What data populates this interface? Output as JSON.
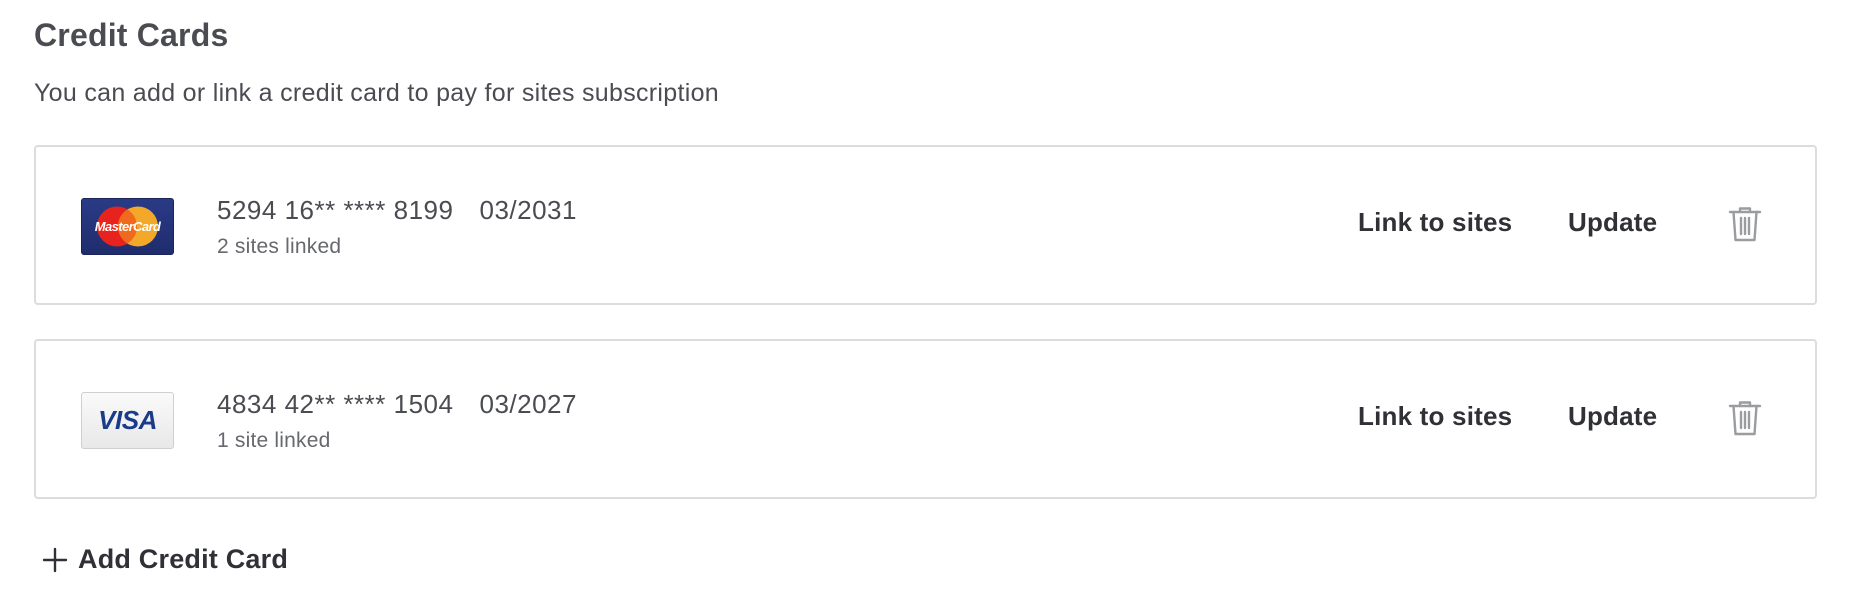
{
  "section": {
    "title": "Credit Cards",
    "subtitle": "You can add or link a credit card to pay for sites subscription"
  },
  "cards": [
    {
      "brand": "MasterCard",
      "logo_icon": "mastercard-logo",
      "number": "5294 16** **** 8199",
      "expiry": "03/2031",
      "linked": "2 sites linked",
      "link_label": "Link to sites",
      "update_label": "Update",
      "delete_icon": "trash-icon"
    },
    {
      "brand": "VISA",
      "logo_icon": "visa-logo",
      "number": "4834 42** **** 1504",
      "expiry": "03/2027",
      "linked": "1 site linked",
      "link_label": "Link to sites",
      "update_label": "Update",
      "delete_icon": "trash-icon"
    }
  ],
  "add_card": {
    "label": "Add Credit Card",
    "icon": "plus-icon"
  },
  "colors": {
    "text_primary": "#2f3136",
    "text_secondary": "#66686e",
    "card_border": "#dcdcdc",
    "icon_gray": "#9a9ca0",
    "mastercard_blue": "#1f2d6d",
    "mastercard_red": "#e8221c",
    "mastercard_yellow": "#f4a82a",
    "visa_blue": "#1a3a8a"
  }
}
